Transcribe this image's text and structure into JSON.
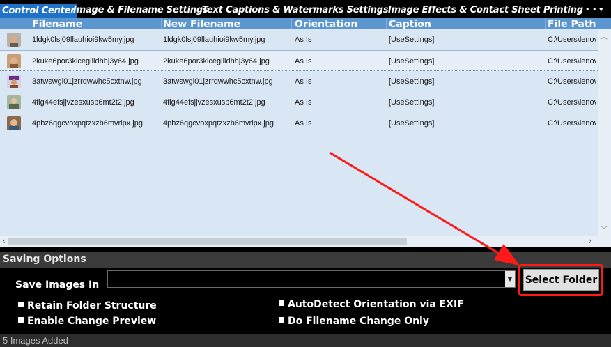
{
  "tabs": [
    {
      "label": "Control Center",
      "active": true
    },
    {
      "label": "Image & Filename Settings",
      "active": false
    },
    {
      "label": "Text Captions & Watermarks Settings",
      "active": false
    },
    {
      "label": "Image Effects & Contact Sheet Printing Se",
      "active": false
    }
  ],
  "tab_controls": {
    "more": "• • ▾"
  },
  "grid": {
    "columns": [
      "Filename",
      "New Filename",
      "Orientation",
      "Caption",
      "File Path"
    ],
    "rows": [
      {
        "filename": "1ldgk0lsj09llauhioi9kw5my.jpg",
        "new_filename": "1ldgk0lsj09llauhioi9kw5my.jpg",
        "orientation": "As Is",
        "caption": "[UseSettings]",
        "file_path": "C:\\Users\\lenov",
        "thumb": "portrait-thumbnail-1"
      },
      {
        "filename": "2kuke6por3klcegllldhhj3y64.jpg",
        "new_filename": "2kuke6por3klcegllldhhj3y64.jpg",
        "orientation": "As Is",
        "caption": "[UseSettings]",
        "file_path": "C:\\Users\\lenov",
        "thumb": "portrait-thumbnail-2"
      },
      {
        "filename": "3atwswgi01jzrrqwwhc5cxtnw.jpg",
        "new_filename": "3atwswgi01jzrrqwwhc5cxtnw.jpg",
        "orientation": "As Is",
        "caption": "[UseSettings]",
        "file_path": "C:\\Users\\lenov",
        "thumb": "portrait-thumbnail-3"
      },
      {
        "filename": "4fig44efsjjvzesxusp6mt2t2.jpg",
        "new_filename": "4fig44efsjjvzesxusp6mt2t2.jpg",
        "orientation": "As Is",
        "caption": "[UseSettings]",
        "file_path": "C:\\Users\\lenov",
        "thumb": "portrait-thumbnail-4"
      },
      {
        "filename": "4pbz6qgcvoxpqtzxzb6mvrlpx.jpg",
        "new_filename": "4pbz6qgcvoxpqtzxzb6mvrlpx.jpg",
        "orientation": "As Is",
        "caption": "[UseSettings]",
        "file_path": "C:\\Users\\lenov",
        "thumb": "portrait-thumbnail-5"
      }
    ]
  },
  "saving_options": {
    "title": "Saving Options",
    "save_label": "Save Images In",
    "folder_value": "",
    "select_folder_label": "Select Folder",
    "checkboxes": {
      "retain": "Retain Folder Structure",
      "preview": "Enable Change Preview",
      "autodetect": "AutoDetect Orientation via EXIF",
      "filename_only": "Do Filename Change Only"
    }
  },
  "status": {
    "text": "5 Images Added"
  },
  "colors": {
    "accent_tab": "#1e73c8",
    "header": "#5b96cf",
    "grid_bg": "#d9e7f5",
    "annotation": "#ff1a1a"
  }
}
